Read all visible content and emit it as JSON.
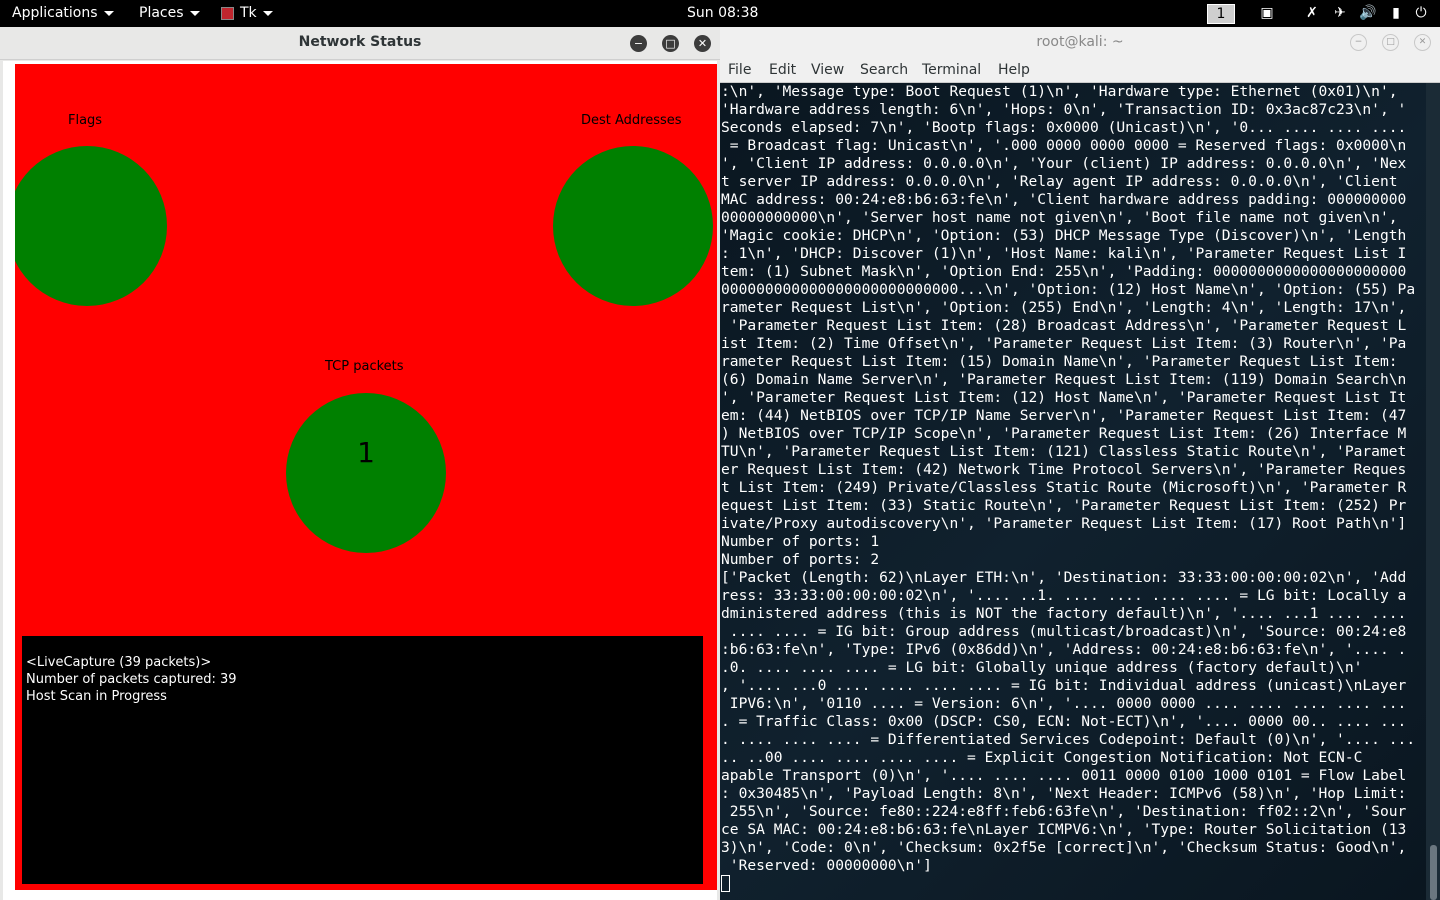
{
  "topbar": {
    "applications": "Applications",
    "places": "Places",
    "tk": "Tk",
    "clock": "Sun 08:38",
    "workspace": "1",
    "icons": [
      "window-switcher-icon",
      "wifi-off-icon",
      "airplane-icon",
      "volume-icon",
      "battery-icon",
      "power-icon"
    ]
  },
  "left_window": {
    "title": "Network Status",
    "labels": {
      "flags": "Flags",
      "dest": "Dest Addresses",
      "tcp": "TCP packets"
    },
    "tcp_value": "1",
    "console": [
      "<LiveCapture (39 packets)>",
      "Number of packets captured: 39",
      "Host Scan in Progress"
    ],
    "colors": {
      "canvas": "#ff0000",
      "circle": "#008000",
      "console": "#000000"
    }
  },
  "right_window": {
    "title": "root@kali: ~",
    "menu": [
      "File",
      "Edit",
      "View",
      "Search",
      "Terminal",
      "Help"
    ],
    "lines": [
      ":\\n', 'Message type: Boot Request (1)\\n', 'Hardware type: Ethernet (0x01)\\n',",
      "'Hardware address length: 6\\n', 'Hops: 0\\n', 'Transaction ID: 0x3ac87c23\\n', '",
      "Seconds elapsed: 7\\n', 'Bootp flags: 0x0000 (Unicast)\\n', '0... .... .... ....",
      " = Broadcast flag: Unicast\\n', '.000 0000 0000 0000 = Reserved flags: 0x0000\\n",
      "', 'Client IP address: 0.0.0.0\\n', 'Your (client) IP address: 0.0.0.0\\n', 'Nex",
      "t server IP address: 0.0.0.0\\n', 'Relay agent IP address: 0.0.0.0\\n', 'Client",
      "MAC address: 00:24:e8:b6:63:fe\\n', 'Client hardware address padding: 000000000",
      "00000000000\\n', 'Server host name not given\\n', 'Boot file name not given\\n',",
      "'Magic cookie: DHCP\\n', 'Option: (53) DHCP Message Type (Discover)\\n', 'Length",
      ": 1\\n', 'DHCP: Discover (1)\\n', 'Host Name: kali\\n', 'Parameter Request List I",
      "tem: (1) Subnet Mask\\n', 'Option End: 255\\n', 'Padding: 0000000000000000000000",
      "000000000000000000000000000...\\n', 'Option: (12) Host Name\\n', 'Option: (55) Pa",
      "rameter Request List\\n', 'Option: (255) End\\n', 'Length: 4\\n', 'Length: 17\\n',",
      " 'Parameter Request List Item: (28) Broadcast Address\\n', 'Parameter Request L",
      "ist Item: (2) Time Offset\\n', 'Parameter Request List Item: (3) Router\\n', 'Pa",
      "rameter Request List Item: (15) Domain Name\\n', 'Parameter Request List Item:",
      "(6) Domain Name Server\\n', 'Parameter Request List Item: (119) Domain Search\\n",
      "', 'Parameter Request List Item: (12) Host Name\\n', 'Parameter Request List It",
      "em: (44) NetBIOS over TCP/IP Name Server\\n', 'Parameter Request List Item: (47",
      ") NetBIOS over TCP/IP Scope\\n', 'Parameter Request List Item: (26) Interface M",
      "TU\\n', 'Parameter Request List Item: (121) Classless Static Route\\n', 'Paramet",
      "er Request List Item: (42) Network Time Protocol Servers\\n', 'Parameter Reques",
      "t List Item: (249) Private/Classless Static Route (Microsoft)\\n', 'Parameter R",
      "equest List Item: (33) Static Route\\n', 'Parameter Request List Item: (252) Pr",
      "ivate/Proxy autodiscovery\\n', 'Parameter Request List Item: (17) Root Path\\n']",
      "Number of ports: 1",
      "Number of ports: 2",
      "['Packet (Length: 62)\\nLayer ETH:\\n', 'Destination: 33:33:00:00:00:02\\n', 'Add",
      "ress: 33:33:00:00:00:02\\n', '.... ..1. .... .... .... .... = LG bit: Locally a",
      "dministered address (this is NOT the factory default)\\n', '.... ...1 .... ....",
      " .... .... = IG bit: Group address (multicast/broadcast)\\n', 'Source: 00:24:e8",
      ":b6:63:fe\\n', 'Type: IPv6 (0x86dd)\\n', 'Address: 00:24:e8:b6:63:fe\\n', '.... .",
      ".0. .... .... .... = LG bit: Globally unique address (factory default)\\n'",
      ", '.... ...0 .... .... .... .... = IG bit: Individual address (unicast)\\nLayer",
      " IPV6:\\n', '0110 .... = Version: 6\\n', '.... 0000 0000 .... .... .... .... ...",
      ". = Traffic Class: 0x00 (DSCP: CS0, ECN: Not-ECT)\\n', '.... 0000 00.. .... ...",
      ". .... .... .... = Differentiated Services Codepoint: Default (0)\\n', '.... ...",
      ".. ..00 .... .... .... .... = Explicit Congestion Notification: Not ECN-C",
      "apable Transport (0)\\n', '.... .... .... 0011 0000 0100 1000 0101 = Flow Label",
      ": 0x30485\\n', 'Payload Length: 8\\n', 'Next Header: ICMPv6 (58)\\n', 'Hop Limit:",
      " 255\\n', 'Source: fe80::224:e8ff:feb6:63fe\\n', 'Destination: ff02::2\\n', 'Sour",
      "ce SA MAC: 00:24:e8:b6:63:fe\\nLayer ICMPV6:\\n', 'Type: Router Solicitation (13",
      "3)\\n', 'Code: 0\\n', 'Checksum: 0x2f5e [correct]\\n', 'Checksum Status: Good\\n',",
      " 'Reserved: 00000000\\n']"
    ]
  }
}
